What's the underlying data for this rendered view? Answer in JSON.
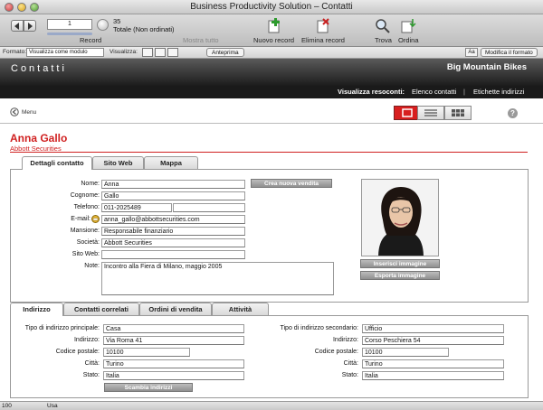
{
  "window": {
    "title": "Business Productivity Solution – Contatti"
  },
  "toolbar": {
    "current_record": "1",
    "record_label": "Record",
    "total_records": "35",
    "status": "Totale (Non ordinati)",
    "show_all": "Mostra tutto",
    "new_record": "Nuovo record",
    "delete_record": "Elimina record",
    "find": "Trova",
    "sort": "Ordina"
  },
  "layoutbar": {
    "layout_label": "Formato:",
    "layout_value": "Visualizza come modulo",
    "view_label": "Visualizza:",
    "preview": "Anteprima",
    "aa": "Aa",
    "edit_layout": "Modifica il formato"
  },
  "header": {
    "module_title": "Contatti",
    "company": "Big Mountain Bikes",
    "reports_label": "Visualizza resoconti:",
    "links": [
      "Elenco contatti",
      "Etichette indirizzi"
    ]
  },
  "menu": {
    "label": "Menu"
  },
  "contact": {
    "full_name": "Anna Gallo",
    "company": "Abbott Securities"
  },
  "tabs": [
    "Dettagli contatto",
    "Sito Web",
    "Mappa"
  ],
  "details": {
    "fields": [
      {
        "label": "Nome:",
        "value": "Anna"
      },
      {
        "label": "Cognome:",
        "value": "Gallo"
      },
      {
        "label": "Telefono:",
        "value": "011-2025489"
      },
      {
        "label": "E-mail:",
        "value": "anna_gallo@abbottsecurities.com"
      },
      {
        "label": "Mansione:",
        "value": "Responsabile finanziario"
      },
      {
        "label": "Società:",
        "value": "Abbott Securities"
      },
      {
        "label": "Sito Web:",
        "value": ""
      },
      {
        "label": "Note:",
        "value": "Incontro alla Fiera di Milano, maggio 2005"
      }
    ],
    "new_sale_button": "Crea nuova vendita",
    "insert_image_button": "Inserisci immagine",
    "export_image_button": "Esporta immagine"
  },
  "lower_tabs": [
    "Indirizzo",
    "Contatti correlati",
    "Ordini di vendita",
    "Attività"
  ],
  "address": {
    "primary_label": "Tipo di indirizzo principale:",
    "secondary_label": "Tipo di indirizzo secondario:",
    "primary": [
      {
        "label": "Indirizzo:",
        "value": "Via Roma 41"
      },
      {
        "label": "Codice postale:",
        "value": "10100"
      },
      {
        "label": "Città:",
        "value": "Turino"
      },
      {
        "label": "Stato:",
        "value": "Italia"
      }
    ],
    "primary_type": "Casa",
    "secondary_type": "Ufficio",
    "secondary": [
      {
        "label": "Indirizzo:",
        "value": "Corso Peschiera 54"
      },
      {
        "label": "Codice postale:",
        "value": "10100"
      },
      {
        "label": "Città:",
        "value": "Turino"
      },
      {
        "label": "Stato:",
        "value": "Italia"
      }
    ],
    "swap_button": "Scambia indirizzi"
  },
  "statusbar": {
    "zoom": "100",
    "mode": "Usa"
  },
  "colors": {
    "accent": "#d02020",
    "header_dark": "#1c1c1c"
  }
}
